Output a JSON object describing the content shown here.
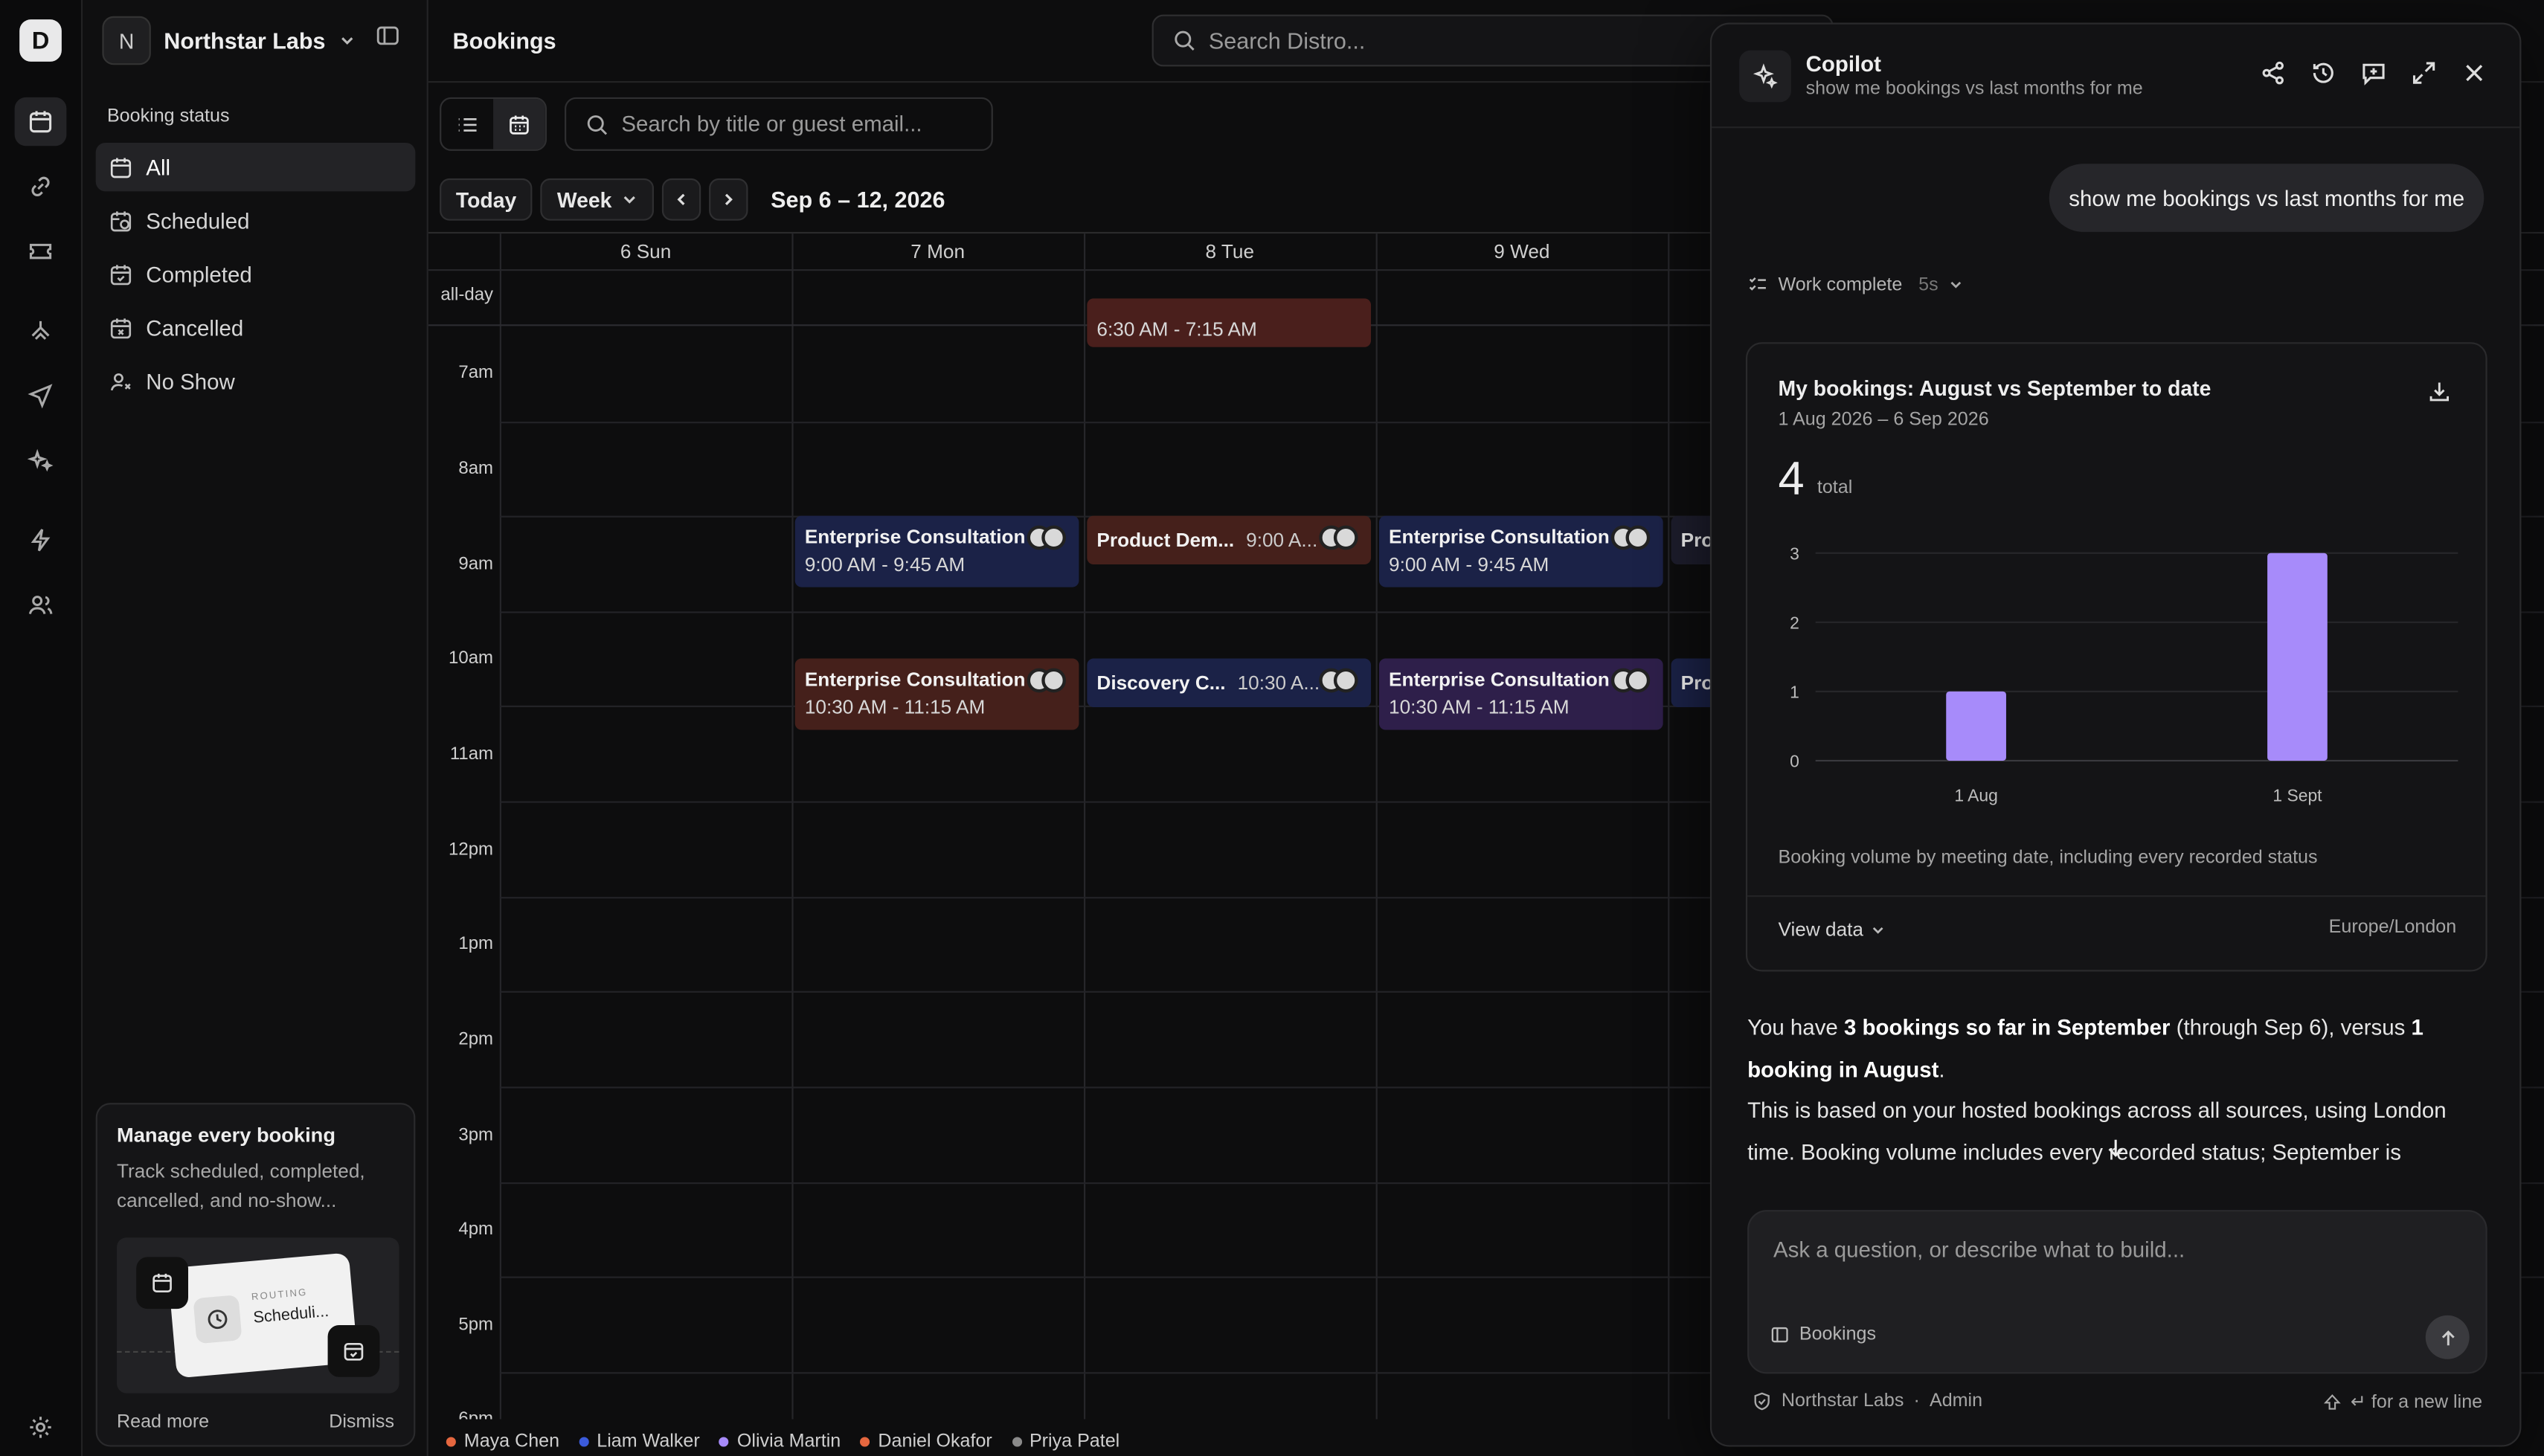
{
  "rail": {
    "logo": "D"
  },
  "org": {
    "initial": "N",
    "name": "Northstar Labs"
  },
  "sidebar": {
    "section_title": "Booking status",
    "items": [
      {
        "label": "All",
        "icon": "calendar-icon"
      },
      {
        "label": "Scheduled",
        "icon": "calendar-clock-icon"
      },
      {
        "label": "Completed",
        "icon": "calendar-check-icon"
      },
      {
        "label": "Cancelled",
        "icon": "calendar-x-icon"
      },
      {
        "label": "No Show",
        "icon": "user-x-icon"
      }
    ],
    "promo": {
      "title": "Manage every booking",
      "desc": "Track scheduled, completed, cancelled, and no-show...",
      "card_kicker": "ROUTING",
      "card_title": "Scheduli...",
      "read_more": "Read more",
      "dismiss": "Dismiss"
    }
  },
  "header": {
    "title": "Bookings",
    "search_placeholder": "Search Distro..."
  },
  "toolbar": {
    "search_placeholder": "Search by title or guest email..."
  },
  "datebar": {
    "today": "Today",
    "view": "Week",
    "range": "Sep 6 – 12, 2026"
  },
  "calendar": {
    "days": [
      "6 Sun",
      "7 Mon",
      "8 Tue",
      "9 Wed",
      ""
    ],
    "allday": "all-day",
    "hours": [
      "7am",
      "8am",
      "9am",
      "10am",
      "11am",
      "12pm",
      "1pm",
      "2pm",
      "3pm",
      "4pm",
      "5pm",
      "6pm"
    ],
    "events": {
      "tue_early": "6:30 AM - 7:15 AM",
      "mon_9_title": "Enterprise Consultation · S",
      "mon_9_time": "9:00 AM - 9:45 AM",
      "tue_9_title": "Product Dem...",
      "tue_9_time": "9:00 A...",
      "wed_9_title": "Enterprise Consultation · /",
      "wed_9_time": "9:00 AM - 9:45 AM",
      "thu_9_title": "Pro",
      "mon_10_title": "Enterprise Consultation · /",
      "mon_10_time": "10:30 AM - 11:15 AM",
      "tue_10_title": "Discovery C...",
      "tue_10_time": "10:30 A...",
      "wed_10_title": "Enterprise Consultation · I",
      "wed_10_time": "10:30 AM - 11:15 AM",
      "thu_10_title": "Pro"
    }
  },
  "legend": [
    {
      "name": "Maya Chen",
      "color": "#e5673f"
    },
    {
      "name": "Liam Walker",
      "color": "#3b5bdb"
    },
    {
      "name": "Olivia Martin",
      "color": "#a78bfa"
    },
    {
      "name": "Daniel Okafor",
      "color": "#e5673f"
    },
    {
      "name": "Priya Patel",
      "color": "#8a8a8a"
    }
  ],
  "copilot": {
    "title": "Copilot",
    "subtitle": "show me bookings vs last months for me",
    "user_message": "show me bookings vs last months for me",
    "work_status": "Work complete",
    "work_duration": "5s",
    "card": {
      "title": "My bookings: August vs September to date",
      "subtitle": "1 Aug 2026 – 6 Sep 2026",
      "total": "4",
      "total_label": "total",
      "caption": "Booking volume by meeting date, including every recorded status",
      "view_data": "View data",
      "timezone": "Europe/London"
    },
    "answer": {
      "p1_a": "You have ",
      "p1_b": "3 bookings so far in September",
      "p1_c": " (through Sep 6), versus ",
      "p1_d": "1 booking in August",
      "p1_e": ".",
      "p2": "This is based on your hosted bookings across all sources, using London time. Booking volume includes every recorded status; September is"
    },
    "composer": {
      "placeholder": "Ask a question, or describe what to build...",
      "context": "Bookings"
    },
    "footer": {
      "org": "Northstar Labs",
      "role": "Admin",
      "hint": "↵ for a new line"
    }
  },
  "chart_data": {
    "type": "bar",
    "title": "My bookings: August vs September to date",
    "categories": [
      "1 Aug",
      "1 Sept"
    ],
    "values": [
      1,
      3
    ],
    "ylim": [
      0,
      3
    ],
    "yticks": [
      "0",
      "1",
      "2",
      "3"
    ],
    "color": "#a78bfa",
    "grid": true
  }
}
